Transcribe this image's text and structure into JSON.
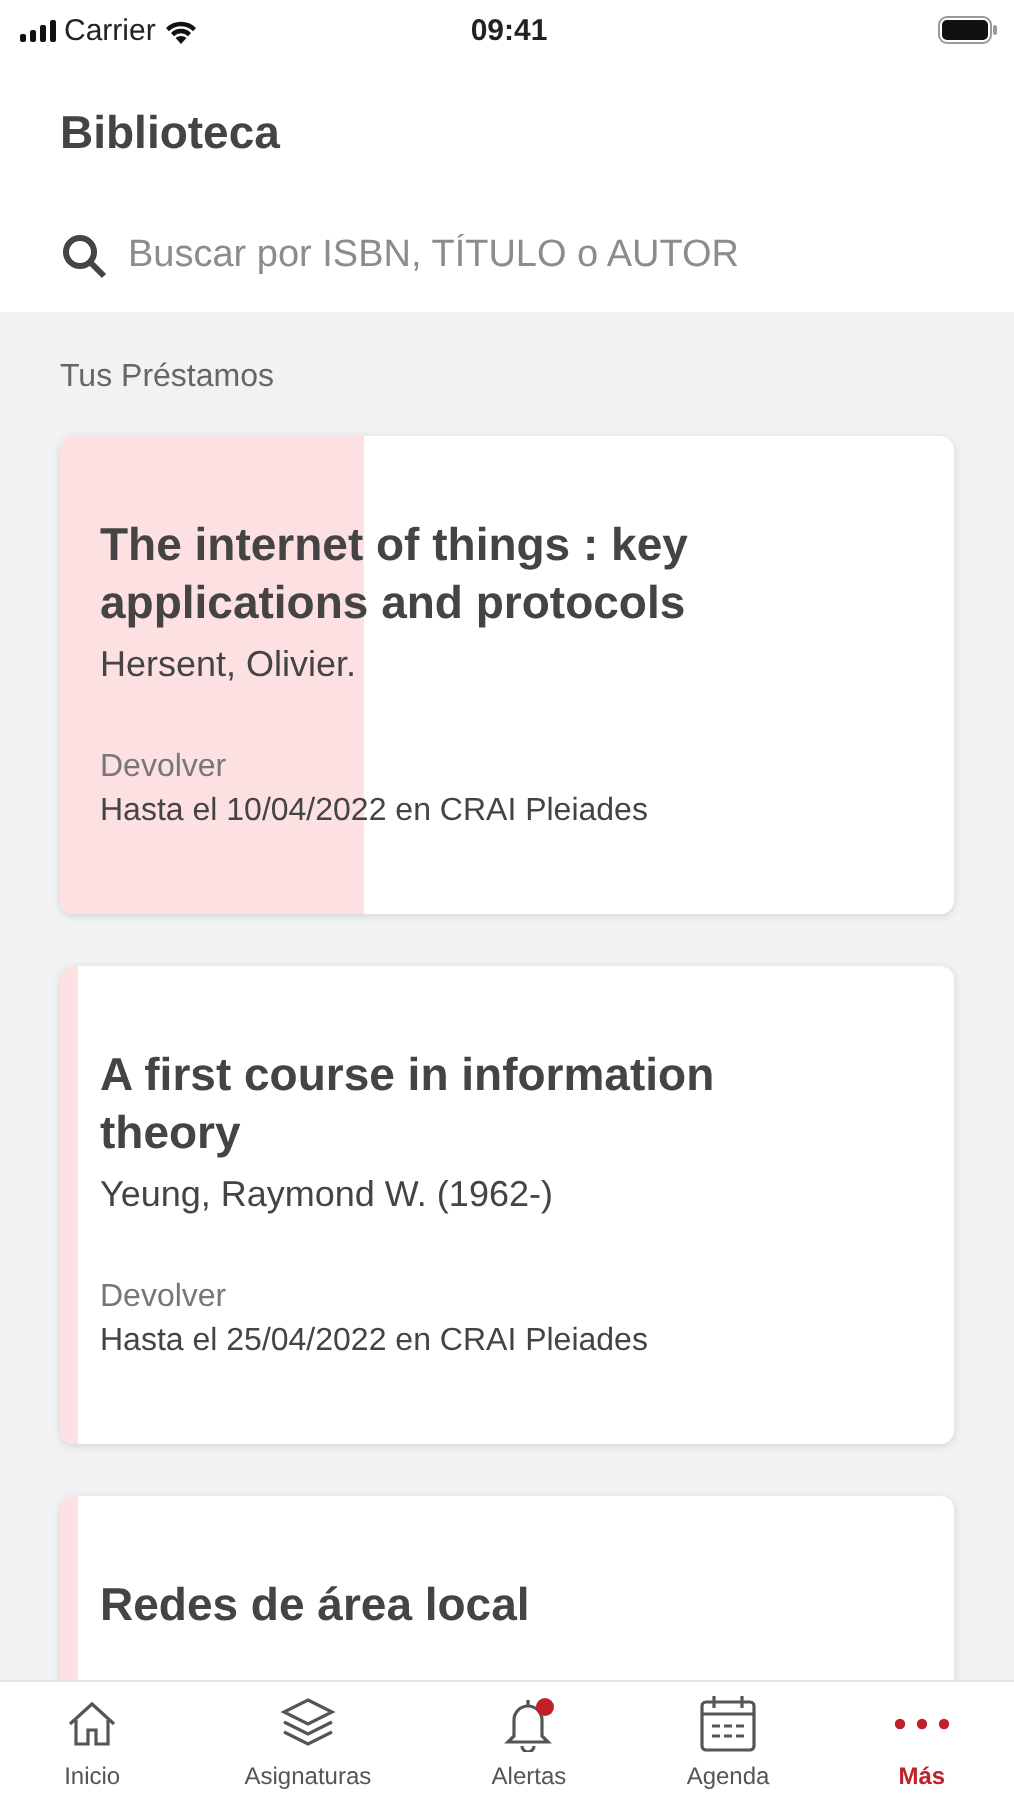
{
  "status_bar": {
    "carrier": "Carrier",
    "time": "09:41"
  },
  "header": {
    "title": "Biblioteca"
  },
  "search": {
    "placeholder": "Buscar por ISBN, TÍTULO o AUTOR"
  },
  "loans_section": {
    "heading": "Tus Préstamos"
  },
  "loans": [
    {
      "title": "The internet of things : key applications and protocols",
      "author": "Hersent, Olivier.",
      "label": "Devolver",
      "due": "Hasta el 10/04/2022 en CRAI Pleiades",
      "level": 0.34
    },
    {
      "title": "A first course in information theory",
      "author": "Yeung, Raymond W. (1962-)",
      "label": "Devolver",
      "due": "Hasta el 25/04/2022 en CRAI Pleiades",
      "level": 0.02
    },
    {
      "title": "Redes de área local",
      "level": 0.02
    }
  ],
  "tab_bar": [
    {
      "label": "Inicio",
      "selected": false,
      "badge": false
    },
    {
      "label": "Asignaturas",
      "selected": false,
      "badge": false
    },
    {
      "label": "Alertas",
      "selected": false,
      "badge": true
    },
    {
      "label": "Agenda",
      "selected": false,
      "badge": false
    },
    {
      "label": "Más",
      "selected": true,
      "badge": false
    }
  ]
}
